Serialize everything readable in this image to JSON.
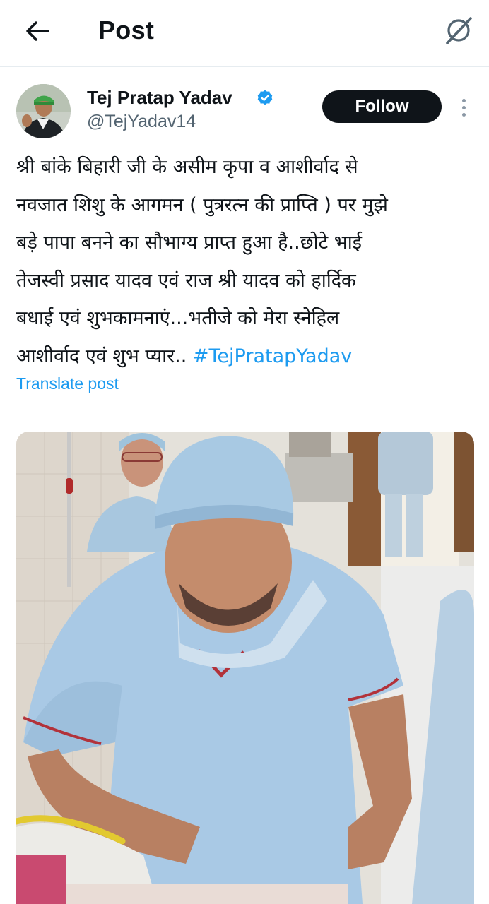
{
  "header": {
    "title": "Post",
    "back_icon": "arrow-left-icon",
    "grok_icon": "grok-icon"
  },
  "post": {
    "author": {
      "name": "Tej Pratap Yadav",
      "handle": "@TejYadav14",
      "verified": true,
      "verified_color": "#1d9bf0"
    },
    "follow_label": "Follow",
    "text_lines": [
      "श्री बांके बिहारी जी के असीम कृपा व आशीर्वाद से",
      "नवजात शिशु के आगमन ( पुत्ररत्न की प्राप्ति ) पर मुझे",
      "बड़े पापा बनने का सौभाग्य प्राप्त हुआ है..छोटे भाई",
      "तेजस्वी प्रसाद यादव एवं राज श्री यादव को हार्दिक",
      "बधाई एवं शुभकामनाएं...भतीजे को मेरा स्नेहिल"
    ],
    "last_line_text": "आशीर्वाद एवं शुभ प्यार.. ",
    "hashtag": "#TejPratapYadav",
    "translate_label": "Translate post",
    "link_color": "#1d9bf0"
  }
}
